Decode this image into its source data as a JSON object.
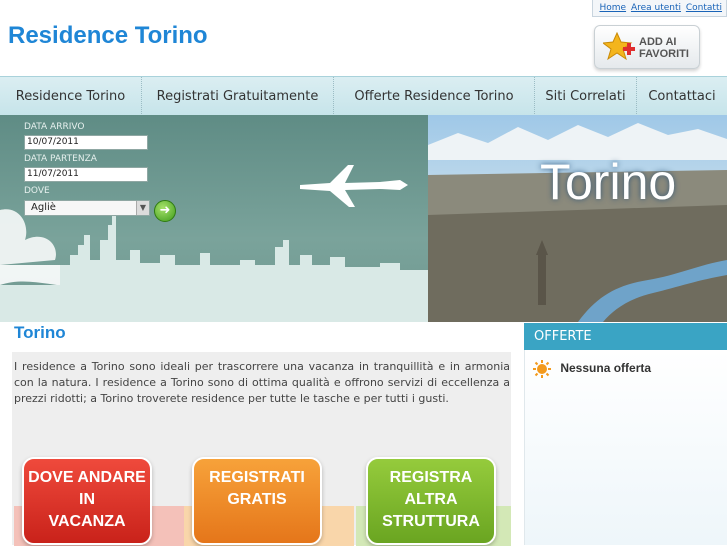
{
  "top_links": {
    "home": "Home",
    "area_utenti": "Area utenti",
    "contatti": "Contatti"
  },
  "site_title": "Residence Torino",
  "favorites": {
    "line1": "ADD AI",
    "line2": "FAVORITI"
  },
  "nav": [
    "Residence Torino",
    "Registrati Gratuitamente",
    "Offerte Residence Torino",
    "Siti Correlati",
    "Contattaci"
  ],
  "form": {
    "arrivo_label": "DATA ARRIVO",
    "arrivo_value": "10/07/2011",
    "partenza_label": "DATA PARTENZA",
    "partenza_value": "11/07/2011",
    "dove_label": "DOVE",
    "dove_value": "Agliè"
  },
  "banner_word": "Torino",
  "main": {
    "title": "Torino",
    "text": "I residence a Torino sono ideali per trascorrere una vacanza in tranquillità e in armonia con la natura. I residence a Torino sono di ottima qualità e offrono servizi di eccellenza a prezzi ridotti; a Torino troverete residence per tutte le tasche e per tutti i gusti."
  },
  "cards": [
    {
      "lines": [
        "DOVE ANDARE",
        "IN",
        "VACANZA"
      ],
      "color": "#e0352b"
    },
    {
      "lines": [
        "REGISTRATI",
        "GRATIS"
      ],
      "color": "#f08a1c"
    },
    {
      "lines": [
        "REGISTRA",
        "ALTRA",
        "STRUTTURA"
      ],
      "color": "#7cb82a"
    }
  ],
  "offers": {
    "heading": "OFFERTE",
    "item": "Nessuna offerta"
  },
  "colors": {
    "accent": "#1f86d6",
    "nav_bg": "#cfe9ee",
    "offers_head": "#3aa4c4"
  }
}
